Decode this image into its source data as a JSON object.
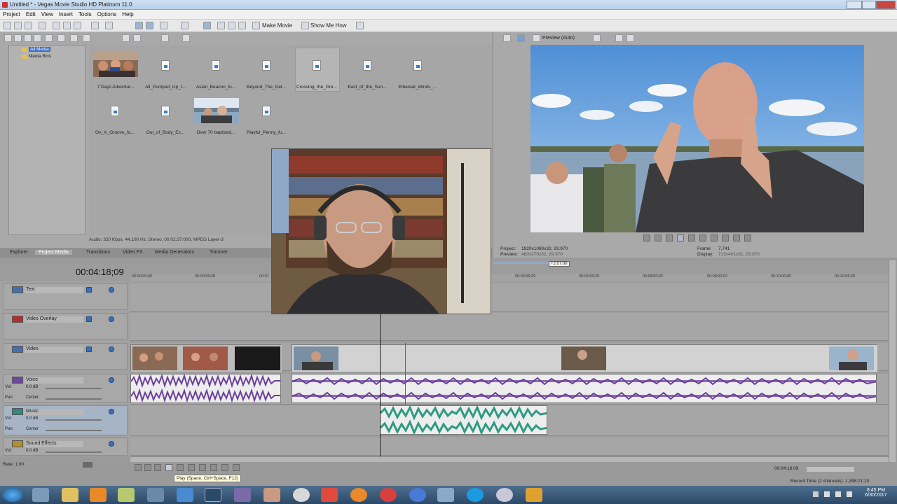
{
  "window": {
    "title": "Untitled * - Vegas Movie Studio HD Platinum 11.0"
  },
  "menu": [
    "Project",
    "Edit",
    "View",
    "Insert",
    "Tools",
    "Options",
    "Help"
  ],
  "toolbar": {
    "make_movie": "Make Movie",
    "show_me_how": "Show Me How"
  },
  "tree": {
    "items": [
      "All Media",
      "Media Bins"
    ]
  },
  "media": {
    "items": [
      "7 Days Adventur...",
      "All_Pumped_Up_f...",
      "Asian_Beacon_fu...",
      "Beyond_The_Del...",
      "Crossing_the_Gre...",
      "East_of_the_Sun...",
      "Ethereal_Winds_...",
      "On_A_Groove_fu...",
      "Out_of_Body_Ex...",
      "Over 70 baptized...",
      "Playful_Penny_fu..."
    ],
    "info": "Audio: 320 Kbps, 44,100 Hz, Stereo, 00:02:37:000, MPEG Layer-3"
  },
  "tabs": [
    "Explorer",
    "Project Media",
    "Transitions",
    "Video FX",
    "Media Generators",
    "Trimmer"
  ],
  "preview": {
    "mode": "Preview (Auto)",
    "project_label": "Project:",
    "project_value": "1920x1080x32, 29.970",
    "preview_label": "Preview:",
    "preview_value": "480x270x32, 29.970",
    "frame_label": "Frame:",
    "frame_value": "7,741",
    "display_label": "Display:",
    "display_value": "713x401x32, 29.970",
    "marker": "+2:07:00"
  },
  "timeline": {
    "timecode": "00:04:18;09",
    "ruler": [
      "00:00:00;00",
      "00:00:59;28",
      "00:01",
      "00:05:59;29",
      "00:06:59;29",
      "00:08:00;02",
      "00:09:00;02",
      "00:10:00;00",
      "00:10:59;28"
    ]
  },
  "tracks": [
    {
      "name": "Text",
      "color": "#4a6fa8"
    },
    {
      "name": "Video Overlay",
      "color": "#b03030"
    },
    {
      "name": "Video",
      "color": "#4a6fa8"
    },
    {
      "name": "Voice",
      "color": "#6a4a9a",
      "vol_label": "Vol:",
      "vol": "0.0 dB",
      "pan_label": "Pan:",
      "pan": "Center"
    },
    {
      "name": "Music",
      "color": "#2e8a7a",
      "vol_label": "Vol:",
      "vol": "0.0 dB",
      "pan_label": "Pan:",
      "pan": "Center"
    },
    {
      "name": "Sound Effects",
      "color": "#b09030",
      "vol_label": "Vol:",
      "vol": "0.0 dB"
    }
  ],
  "status": {
    "rate": "Rate: 1.00",
    "tooltip": "Play (Space, Ctrl+Space, F12)",
    "end_time": "00:04:18;09",
    "record_time": "Record Time (2 channels): 1,398:21:20"
  },
  "taskbar": {
    "time": "8:45 PM",
    "date": "6/30/2017"
  }
}
